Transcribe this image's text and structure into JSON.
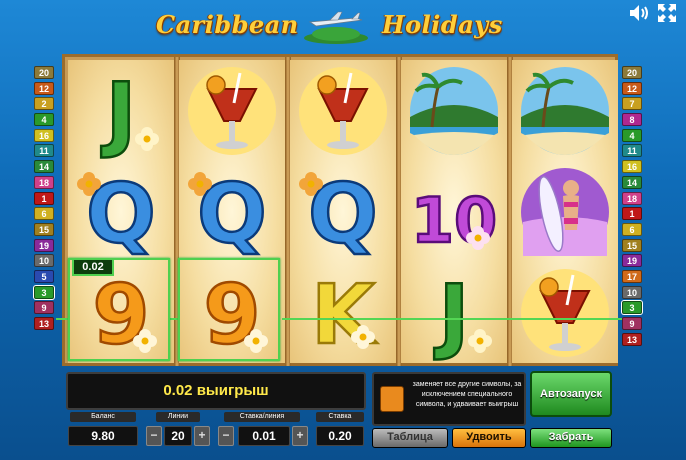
{
  "title": {
    "part1": "Caribbean",
    "part2": "Holidays"
  },
  "top_icons": {
    "sound": "speaker-icon",
    "fullscreen": "fullscreen-icon"
  },
  "left_lines": [
    {
      "n": "20",
      "color": "#8c7a3a"
    },
    {
      "n": "12",
      "color": "#c85a1a"
    },
    {
      "n": "2",
      "color": "#c8a020"
    },
    {
      "n": "4",
      "color": "#2a9a2a"
    },
    {
      "n": "16",
      "color": "#d0c020"
    },
    {
      "n": "11",
      "color": "#208a8a"
    },
    {
      "n": "14",
      "color": "#2a8a3a"
    },
    {
      "n": "18",
      "color": "#d0408a"
    },
    {
      "n": "1",
      "color": "#c01818"
    },
    {
      "n": "6",
      "color": "#d0b020"
    },
    {
      "n": "15",
      "color": "#a08020"
    },
    {
      "n": "19",
      "color": "#8a2a9a"
    },
    {
      "n": "10",
      "color": "#6a6a6a"
    },
    {
      "n": "5",
      "color": "#2a4ab0"
    },
    {
      "n": "3",
      "color": "#2a9a2a"
    },
    {
      "n": "9",
      "color": "#a03060"
    },
    {
      "n": "13",
      "color": "#b02020"
    }
  ],
  "right_lines": [
    {
      "n": "20",
      "color": "#8c7a3a"
    },
    {
      "n": "12",
      "color": "#c85a1a"
    },
    {
      "n": "7",
      "color": "#c8a020"
    },
    {
      "n": "8",
      "color": "#b02890"
    },
    {
      "n": "4",
      "color": "#2a9a2a"
    },
    {
      "n": "11",
      "color": "#208a8a"
    },
    {
      "n": "16",
      "color": "#d0c020"
    },
    {
      "n": "14",
      "color": "#2a8a3a"
    },
    {
      "n": "18",
      "color": "#d0408a"
    },
    {
      "n": "1",
      "color": "#c01818"
    },
    {
      "n": "6",
      "color": "#d0b020"
    },
    {
      "n": "15",
      "color": "#a08020"
    },
    {
      "n": "19",
      "color": "#8a2a9a"
    },
    {
      "n": "17",
      "color": "#d06a1a"
    },
    {
      "n": "10",
      "color": "#6a6a6a"
    },
    {
      "n": "3",
      "color": "#2a9a2a"
    },
    {
      "n": "9",
      "color": "#a03060"
    },
    {
      "n": "13",
      "color": "#b02020"
    }
  ],
  "active_line": "3",
  "reels": [
    [
      "J",
      "Q",
      "9"
    ],
    [
      "cocktail",
      "Q",
      "9"
    ],
    [
      "cocktail",
      "Q",
      "K"
    ],
    [
      "palms",
      "10",
      "J"
    ],
    [
      "palms",
      "surfer-girl",
      "cocktail"
    ]
  ],
  "win_tag": "0.02",
  "win_message": "0.02 выигрыш",
  "info_text": "заменяет все другие символы, за исключением специального символа, и удваивает выигрыш",
  "labels": {
    "balance": "Баланс",
    "lines": "Линии",
    "bet_per_line": "Ставка/линия",
    "bet": "Ставка"
  },
  "values": {
    "balance": "9.80",
    "lines": "20",
    "bet_per_line": "0.01",
    "bet": "0.20"
  },
  "steppers": {
    "minus": "−",
    "plus": "+"
  },
  "buttons": {
    "autostart": "Автозапуск",
    "table": "Таблица",
    "double": "Удвоить",
    "take": "Забрать"
  },
  "colors": {
    "win_green": "#4fd04f",
    "win_text": "#ffe94a"
  }
}
